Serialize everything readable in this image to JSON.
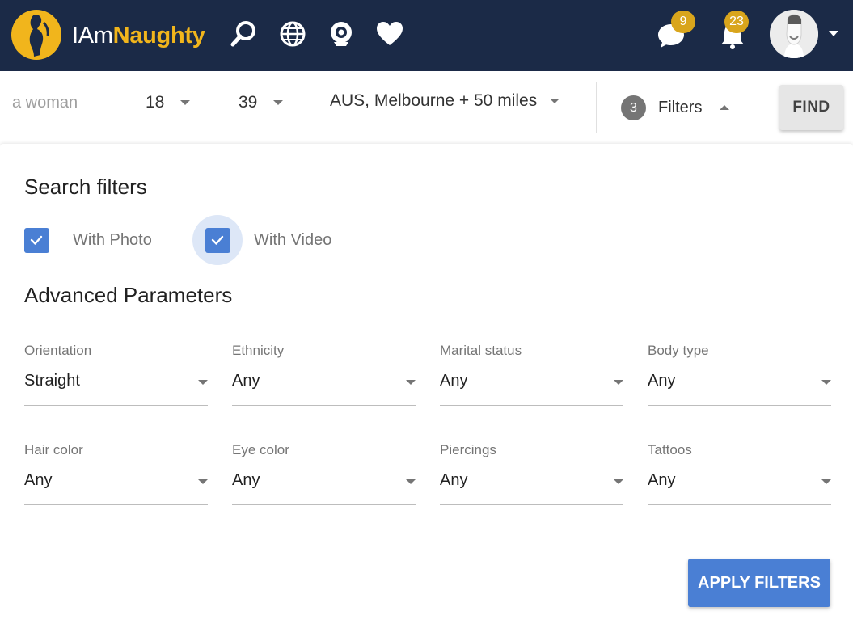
{
  "brand": {
    "part1": "IAm",
    "part2": "Naughty"
  },
  "nav": {
    "icons": [
      "search-icon",
      "globe-icon",
      "webcam-icon",
      "heart-icon",
      "chat-icon",
      "bell-icon"
    ],
    "messages_count": "9",
    "notifications_count": "23"
  },
  "colors": {
    "navbar": "#1b2a47",
    "brand_accent": "#f1b51c",
    "badge": "#d9a51c",
    "primary": "#4a7fd4"
  },
  "search": {
    "seeking": "a woman",
    "age_min": "18",
    "age_max": "39",
    "location": "AUS, Melbourne + 50 miles",
    "filters_count": "3",
    "filters_label": "Filters",
    "find_label": "FIND"
  },
  "panel": {
    "search_filters_title": "Search filters",
    "with_photo": {
      "label": "With Photo",
      "checked": true
    },
    "with_video": {
      "label": "With Video",
      "checked": true
    },
    "advanced_title": "Advanced Parameters",
    "fields": [
      {
        "label": "Orientation",
        "value": "Straight"
      },
      {
        "label": "Ethnicity",
        "value": "Any"
      },
      {
        "label": "Marital status",
        "value": "Any"
      },
      {
        "label": "Body type",
        "value": "Any"
      },
      {
        "label": "Hair color",
        "value": "Any"
      },
      {
        "label": "Eye color",
        "value": "Any"
      },
      {
        "label": "Piercings",
        "value": "Any"
      },
      {
        "label": "Tattoos",
        "value": "Any"
      }
    ],
    "apply_label": "APPLY FILTERS"
  }
}
